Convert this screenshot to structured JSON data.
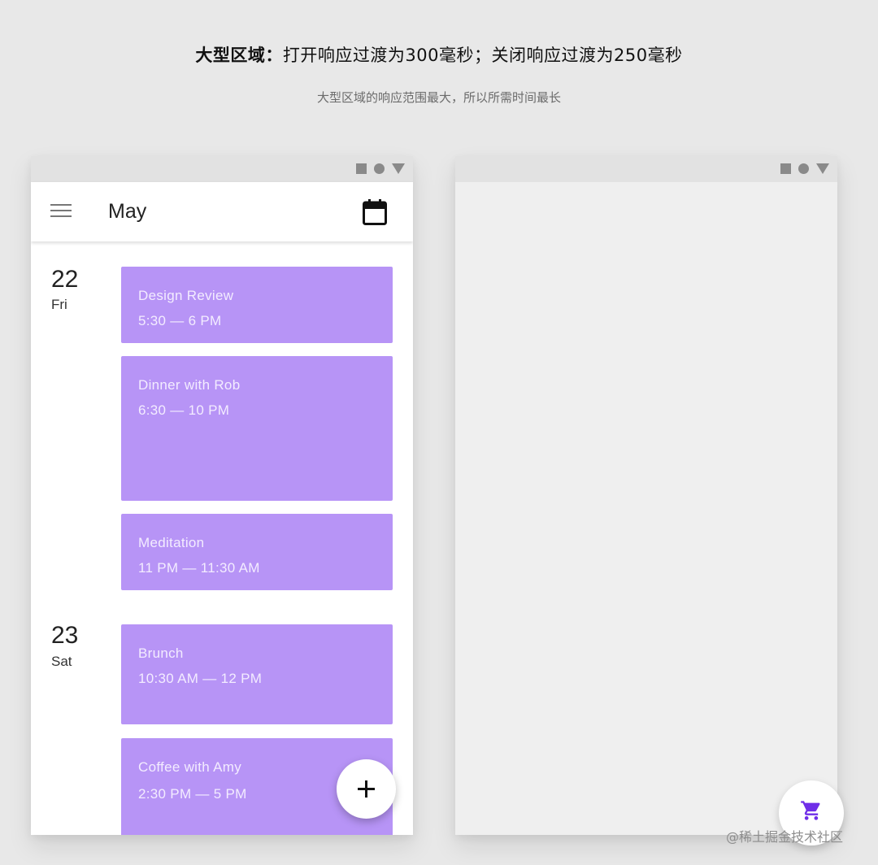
{
  "header": {
    "title_strong": "大型区域：",
    "title_rest": "打开响应过渡为300毫秒；关闭响应过渡为250毫秒",
    "subtitle": "大型区域的响应范围最大，所以所需时间最长"
  },
  "left_phone": {
    "appbar": {
      "menu_icon": "menu-icon",
      "title": "May",
      "calendar_icon": "calendar-icon"
    },
    "days": [
      {
        "number": "22",
        "name": "Fri"
      },
      {
        "number": "23",
        "name": "Sat"
      }
    ],
    "events": [
      {
        "title": "Design Review",
        "time": "5:30 — 6 PM"
      },
      {
        "title": "Dinner with Rob",
        "time": "6:30 — 10 PM"
      },
      {
        "title": "Meditation",
        "time": "11 PM — 11:30 AM"
      },
      {
        "title": "Brunch",
        "time": "10:30 AM — 12 PM"
      },
      {
        "title": "Coffee with Amy",
        "time": "2:30 PM — 5 PM"
      }
    ],
    "fab_icon": "plus-icon"
  },
  "right_phone": {
    "fab_icon": "shopping-cart-icon"
  },
  "colors": {
    "event_bg": "#b794f6",
    "event_text": "#f3ecff",
    "cart_accent": "#6f2ee8"
  },
  "watermark": "@稀土掘金技术社区"
}
